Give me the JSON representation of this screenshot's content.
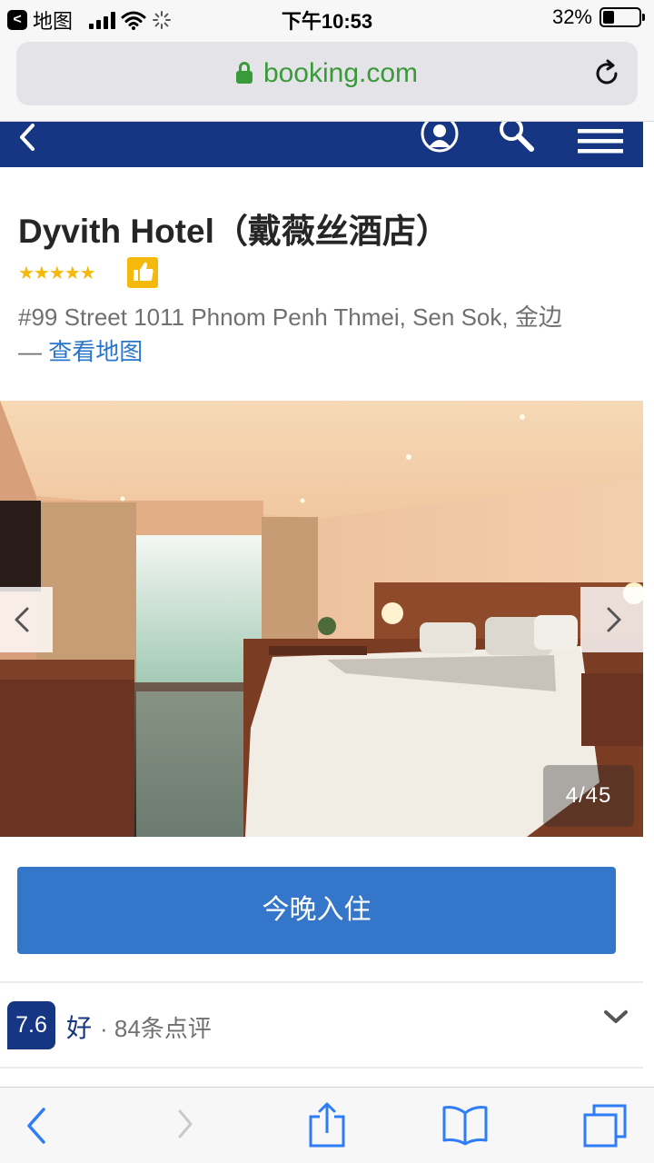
{
  "status_bar": {
    "back_app_label": "地图",
    "time": "下午10:53",
    "battery_percent": "32%",
    "battery_level": 0.32
  },
  "browser": {
    "url": "booking.com"
  },
  "hotel": {
    "name": "Dyvith Hotel（戴薇丝酒店）",
    "stars": "★★★★★",
    "star_rating": 5,
    "address": "#99 Street 1011 Phnom Penh Thmei, Sen Sok, 金边",
    "address_separator": "— ",
    "map_link": "查看地图"
  },
  "gallery": {
    "counter": "4/45"
  },
  "booking": {
    "book_button": "今晚入住"
  },
  "reviews": {
    "score": "7.6",
    "score_word": "好",
    "count_text": "· 84条点评"
  },
  "colors": {
    "brand_navy": "#163683",
    "button_blue": "#3476c9",
    "link_blue": "#2a76cc",
    "star_gold": "#f5b80d",
    "secure_green": "#3a9a3a",
    "ios_blue": "#2f7df6"
  }
}
